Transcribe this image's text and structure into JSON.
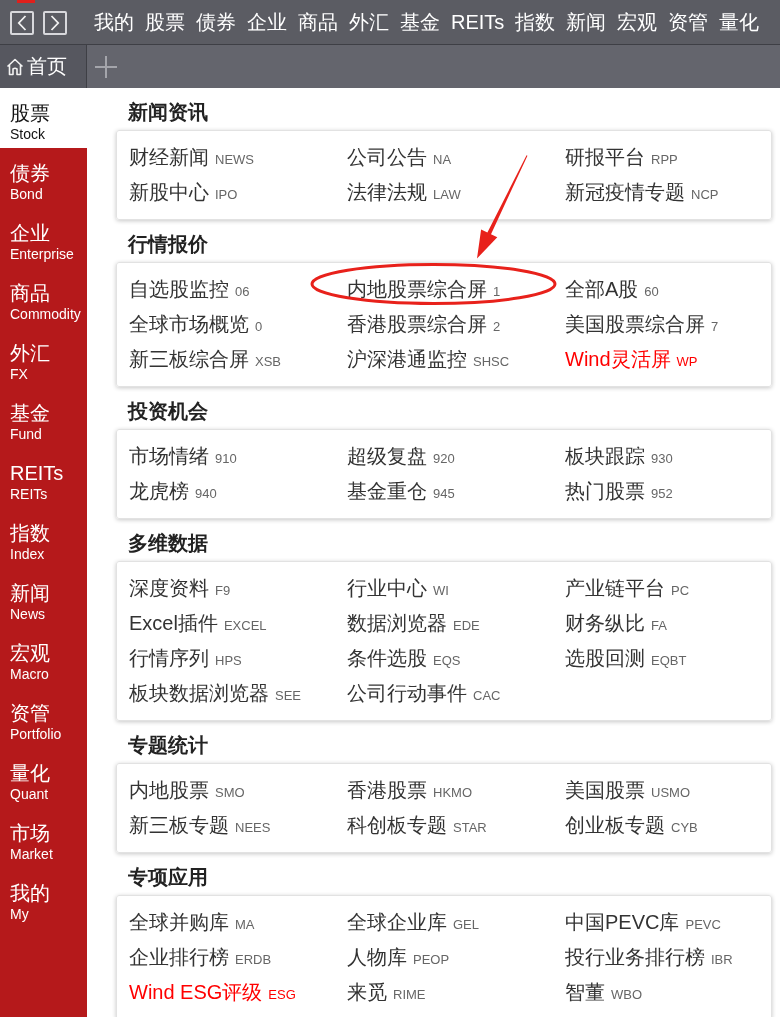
{
  "top_menu": [
    "我的",
    "股票",
    "债券",
    "企业",
    "商品",
    "外汇",
    "基金",
    "REITs",
    "指数",
    "新闻",
    "宏观",
    "资管",
    "量化"
  ],
  "tabs": [
    {
      "label": "首页",
      "selected": true
    }
  ],
  "sidebar": {
    "items": [
      {
        "label": "股票",
        "sublabel": "Stock",
        "selected": true
      },
      {
        "label": "债券",
        "sublabel": "Bond",
        "selected": false
      },
      {
        "label": "企业",
        "sublabel": "Enterprise",
        "selected": false
      },
      {
        "label": "商品",
        "sublabel": "Commodity",
        "selected": false
      },
      {
        "label": "外汇",
        "sublabel": "FX",
        "selected": false
      },
      {
        "label": "基金",
        "sublabel": "Fund",
        "selected": false
      },
      {
        "label": "REITs",
        "sublabel": "REITs",
        "selected": false
      },
      {
        "label": "指数",
        "sublabel": "Index",
        "selected": false
      },
      {
        "label": "新闻",
        "sublabel": "News",
        "selected": false
      },
      {
        "label": "宏观",
        "sublabel": "Macro",
        "selected": false
      },
      {
        "label": "资管",
        "sublabel": "Portfolio",
        "selected": false
      },
      {
        "label": "量化",
        "sublabel": "Quant",
        "selected": false
      },
      {
        "label": "市场",
        "sublabel": "Market",
        "selected": false
      },
      {
        "label": "我的",
        "sublabel": "My",
        "selected": false
      }
    ]
  },
  "sections": [
    {
      "title": "新闻资讯",
      "items": [
        {
          "name": "财经新闻",
          "code": "NEWS",
          "featured": false,
          "circled": false
        },
        {
          "name": "公司公告",
          "code": "NA",
          "featured": false,
          "circled": false
        },
        {
          "name": "研报平台",
          "code": "RPP",
          "featured": false,
          "circled": false
        },
        {
          "name": "新股中心",
          "code": "IPO",
          "featured": false,
          "circled": false
        },
        {
          "name": "法律法规",
          "code": "LAW",
          "featured": false,
          "circled": false
        },
        {
          "name": "新冠疫情专题",
          "code": "NCP",
          "featured": false,
          "circled": false
        }
      ]
    },
    {
      "title": "行情报价",
      "items": [
        {
          "name": "自选股监控",
          "code": "06",
          "featured": false,
          "circled": false
        },
        {
          "name": "内地股票综合屏",
          "code": "1",
          "featured": false,
          "circled": true
        },
        {
          "name": "全部A股",
          "code": "60",
          "featured": false,
          "circled": false
        },
        {
          "name": "全球市场概览",
          "code": "0",
          "featured": false,
          "circled": false
        },
        {
          "name": "香港股票综合屏",
          "code": "2",
          "featured": false,
          "circled": false
        },
        {
          "name": "美国股票综合屏",
          "code": "7",
          "featured": false,
          "circled": false
        },
        {
          "name": "新三板综合屏",
          "code": "XSB",
          "featured": false,
          "circled": false
        },
        {
          "name": "沪深港通监控",
          "code": "SHSC",
          "featured": false,
          "circled": false
        },
        {
          "name": "Wind灵活屏",
          "code": "WP",
          "featured": true,
          "circled": false
        }
      ]
    },
    {
      "title": "投资机会",
      "items": [
        {
          "name": "市场情绪",
          "code": "910",
          "featured": false,
          "circled": false
        },
        {
          "name": "超级复盘",
          "code": "920",
          "featured": false,
          "circled": false
        },
        {
          "name": "板块跟踪",
          "code": "930",
          "featured": false,
          "circled": false
        },
        {
          "name": "龙虎榜",
          "code": "940",
          "featured": false,
          "circled": false
        },
        {
          "name": "基金重仓",
          "code": "945",
          "featured": false,
          "circled": false
        },
        {
          "name": "热门股票",
          "code": "952",
          "featured": false,
          "circled": false
        }
      ]
    },
    {
      "title": "多维数据",
      "items": [
        {
          "name": "深度资料",
          "code": "F9",
          "featured": false,
          "circled": false
        },
        {
          "name": "行业中心",
          "code": "WI",
          "featured": false,
          "circled": false
        },
        {
          "name": "产业链平台",
          "code": "PC",
          "featured": false,
          "circled": false
        },
        {
          "name": "Excel插件",
          "code": "EXCEL",
          "featured": false,
          "circled": false
        },
        {
          "name": "数据浏览器",
          "code": "EDE",
          "featured": false,
          "circled": false
        },
        {
          "name": "财务纵比",
          "code": "FA",
          "featured": false,
          "circled": false
        },
        {
          "name": "行情序列",
          "code": "HPS",
          "featured": false,
          "circled": false
        },
        {
          "name": "条件选股",
          "code": "EQS",
          "featured": false,
          "circled": false
        },
        {
          "name": "选股回测",
          "code": "EQBT",
          "featured": false,
          "circled": false
        },
        {
          "name": "板块数据浏览器",
          "code": "SEE",
          "featured": false,
          "circled": false
        },
        {
          "name": "公司行动事件",
          "code": "CAC",
          "featured": false,
          "circled": false
        }
      ]
    },
    {
      "title": "专题统计",
      "items": [
        {
          "name": "内地股票",
          "code": "SMO",
          "featured": false,
          "circled": false
        },
        {
          "name": "香港股票",
          "code": "HKMO",
          "featured": false,
          "circled": false
        },
        {
          "name": "美国股票",
          "code": "USMO",
          "featured": false,
          "circled": false
        },
        {
          "name": "新三板专题",
          "code": "NEES",
          "featured": false,
          "circled": false
        },
        {
          "name": "科创板专题",
          "code": "STAR",
          "featured": false,
          "circled": false
        },
        {
          "name": "创业板专题",
          "code": "CYB",
          "featured": false,
          "circled": false
        }
      ]
    },
    {
      "title": "专项应用",
      "items": [
        {
          "name": "全球并购库",
          "code": "MA",
          "featured": false,
          "circled": false
        },
        {
          "name": "全球企业库",
          "code": "GEL",
          "featured": false,
          "circled": false
        },
        {
          "name": "中国PEVC库",
          "code": "PEVC",
          "featured": false,
          "circled": false
        },
        {
          "name": "企业排行榜",
          "code": "ERDB",
          "featured": false,
          "circled": false
        },
        {
          "name": "人物库",
          "code": "PEOP",
          "featured": false,
          "circled": false
        },
        {
          "name": "投行业务排行榜",
          "code": "IBR",
          "featured": false,
          "circled": false
        },
        {
          "name": "Wind ESG评级",
          "code": "ESG",
          "featured": true,
          "circled": false
        },
        {
          "name": "来觅",
          "code": "RIME",
          "featured": false,
          "circled": false
        },
        {
          "name": "智董",
          "code": "WBO",
          "featured": false,
          "circled": false
        }
      ]
    }
  ]
}
